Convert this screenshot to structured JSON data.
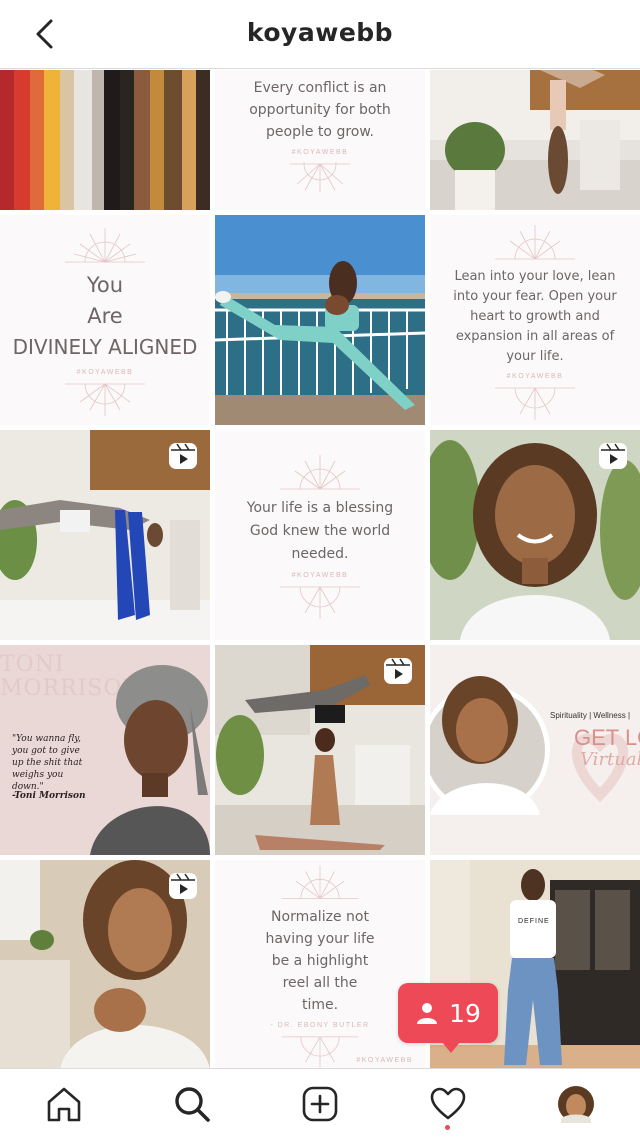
{
  "header": {
    "title": "koyawebb",
    "back_icon": "chevron-left-icon"
  },
  "grid": {
    "quote_top": "Every conflict is an opportunity for both people to grow.",
    "divine": {
      "line1": "You",
      "line2": "Are",
      "line3": "DIVINELY ALIGNED"
    },
    "lean_quote": "Lean into your love, lean into your fear. Open your heart to growth and expansion in all areas of your life.",
    "blessing_quote": "Your life is a blessing God knew the world needed.",
    "toni": {
      "quote": "\"You wanna fly, you got to give up the shit that weighs you down.\"",
      "author": "-Toni Morrison",
      "watermark": "TONI MORRISON"
    },
    "promo": {
      "line1": "Spirituality | Wellness |",
      "line2": "GET LOV",
      "line3": "Virtual"
    },
    "normalize_quote": "Normalize not having your life be a highlight reel all the time.",
    "normalize_author": "- DR. EBONY BUTLER",
    "shirt_text": "DEFINE",
    "tag": "#KOYAWEBB"
  },
  "activity": {
    "count": "19",
    "icon": "person-icon"
  },
  "nav": {
    "items": [
      "home-icon",
      "search-icon",
      "add-icon",
      "heart-icon",
      "profile-avatar"
    ]
  },
  "colors": {
    "accent": "#ed4956",
    "quote_text": "#6d6566",
    "quote_bg": "#fbf9f9",
    "divider": "#dbdbdb"
  }
}
